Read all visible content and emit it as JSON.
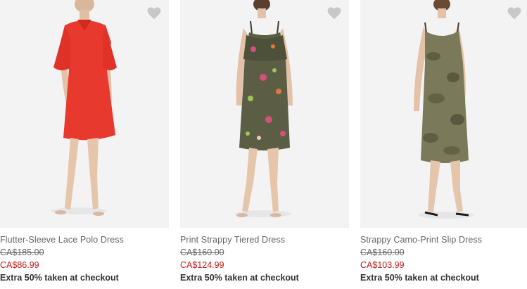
{
  "products": [
    {
      "name": "Flutter-Sleeve Lace Polo Dress",
      "original_price": "CA$185.00",
      "sale_price": "CA$86.99",
      "promo": "Extra 50% taken at checkout",
      "dress_color": "#e8392f",
      "image_icon": "product-photo"
    },
    {
      "name": "Print Strappy Tiered Dress",
      "original_price": "CA$160.00",
      "sale_price": "CA$124.99",
      "promo": "Extra 50% taken at checkout",
      "dress_color": "#5b5e45",
      "image_icon": "product-photo"
    },
    {
      "name": "Strappy Camo-Print Slip Dress",
      "original_price": "CA$160.00",
      "sale_price": "CA$103.99",
      "promo": "Extra 50% taken at checkout",
      "dress_color": "#6f6f52",
      "image_icon": "product-photo"
    }
  ],
  "colors": {
    "sale_price": "#c41b16",
    "text": "#666666",
    "heart": "#c8c8c8"
  }
}
